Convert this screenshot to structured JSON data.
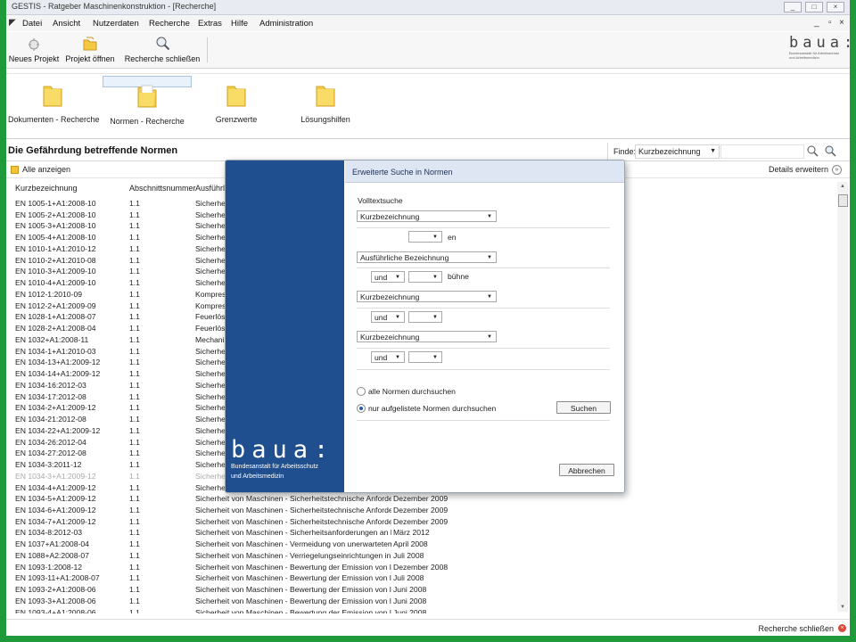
{
  "window": {
    "title": "GESTIS - Ratgeber Maschinenkonstruktion - [Recherche]",
    "controls": [
      "_",
      "□",
      "×"
    ]
  },
  "menu": [
    "Datei",
    "Ansicht",
    "Nutzerdaten",
    "Recherche",
    "Extras",
    "Hilfe",
    "Administration"
  ],
  "toolbar": {
    "new_project": "Neues Projekt",
    "open_project": "Projekt öffnen",
    "close_search": "Recherche schließen",
    "logo_text": "baua:",
    "logo_sub": "Bundesanstalt für Arbeitsschutz und Arbeitsmedizin"
  },
  "categories": [
    "Dokumenten - Recherche",
    "Normen - Recherche",
    "Grenzwerte",
    "Lösungshilfen"
  ],
  "selected_category": "Normen - Recherche",
  "section_title": "Die Gefährdung betreffende Normen",
  "find": {
    "label": "Finde:",
    "field": "Kurzbezeichnung"
  },
  "show_all": "Alle anzeigen",
  "details": "Details erweitern",
  "columns": [
    "Kurzbezeichnung",
    "Abschnittsnummer",
    "Ausführlic"
  ],
  "rows": [
    {
      "k": "EN 1005-1+A1:2008-10",
      "a": "1.1",
      "d": "Sicherheit",
      "dt": ""
    },
    {
      "k": "EN 1005-2+A1:2008-10",
      "a": "1.1",
      "d": "Sicherheit",
      "dt": ""
    },
    {
      "k": "EN 1005-3+A1:2008-10",
      "a": "1.1",
      "d": "Sicherheit",
      "dt": ""
    },
    {
      "k": "EN 1005-4+A1:2008-10",
      "a": "1.1",
      "d": "Sicherheit",
      "dt": ""
    },
    {
      "k": "EN 1010-1+A1:2010-12",
      "a": "1.1",
      "d": "Sicherheit",
      "dt": ""
    },
    {
      "k": "EN 1010-2+A1:2010-08",
      "a": "1.1",
      "d": "Sicherheit",
      "dt": ""
    },
    {
      "k": "EN 1010-3+A1:2009-10",
      "a": "1.1",
      "d": "Sicherheit",
      "dt": ""
    },
    {
      "k": "EN 1010-4+A1:2009-10",
      "a": "1.1",
      "d": "Sicherheit",
      "dt": ""
    },
    {
      "k": "EN 1012-1:2010-09",
      "a": "1.1",
      "d": "Kompress",
      "dt": ""
    },
    {
      "k": "EN 1012-2+A1:2009-09",
      "a": "1.1",
      "d": "Kompress",
      "dt": ""
    },
    {
      "k": "EN 1028-1+A1:2008-07",
      "a": "1.1",
      "d": "Feuerlösc",
      "dt": ""
    },
    {
      "k": "EN 1028-2+A1:2008-04",
      "a": "1.1",
      "d": "Feuerlösc",
      "dt": ""
    },
    {
      "k": "EN 1032+A1:2008-11",
      "a": "1.1",
      "d": "Mechanis",
      "dt": ""
    },
    {
      "k": "EN 1034-1+A1:2010-03",
      "a": "1.1",
      "d": "Sicherheit",
      "dt": ""
    },
    {
      "k": "EN 1034-13+A1:2009-12",
      "a": "1.1",
      "d": "Sicherheit",
      "dt": ""
    },
    {
      "k": "EN 1034-14+A1:2009-12",
      "a": "1.1",
      "d": "Sicherheit",
      "dt": ""
    },
    {
      "k": "EN 1034-16:2012-03",
      "a": "1.1",
      "d": "Sicherheit",
      "dt": ""
    },
    {
      "k": "EN 1034-17:2012-08",
      "a": "1.1",
      "d": "Sicherheit",
      "dt": ""
    },
    {
      "k": "EN 1034-2+A1:2009-12",
      "a": "1.1",
      "d": "Sicherheit",
      "dt": ""
    },
    {
      "k": "EN 1034-21:2012-08",
      "a": "1.1",
      "d": "Sicherheit",
      "dt": ""
    },
    {
      "k": "EN 1034-22+A1:2009-12",
      "a": "1.1",
      "d": "Sicherheit",
      "dt": ""
    },
    {
      "k": "EN 1034-26:2012-04",
      "a": "1.1",
      "d": "Sicherheit",
      "dt": ""
    },
    {
      "k": "EN 1034-27:2012-08",
      "a": "1.1",
      "d": "Sicherheit",
      "dt": ""
    },
    {
      "k": "EN 1034-3:2011-12",
      "a": "1.1",
      "d": "Sicherheit",
      "dt": ""
    },
    {
      "k": "EN 1034-3+A1:2009-12",
      "a": "1.1",
      "d": "Sicherheit",
      "dt": "",
      "faded": true
    },
    {
      "k": "EN 1034-4+A1:2009-12",
      "a": "1.1",
      "d": "Sicherheit",
      "dt": ""
    },
    {
      "k": "EN 1034-5+A1:2009-12",
      "a": "1.1",
      "d": "Sicherheit von Maschinen - Sicherheitstechnische Anforder...",
      "dt": "Dezember 2009"
    },
    {
      "k": "EN 1034-6+A1:2009-12",
      "a": "1.1",
      "d": "Sicherheit von Maschinen - Sicherheitstechnische Anforder...",
      "dt": "Dezember 2009"
    },
    {
      "k": "EN 1034-7+A1:2009-12",
      "a": "1.1",
      "d": "Sicherheit von Maschinen - Sicherheitstechnische Anforder...",
      "dt": "Dezember 2009"
    },
    {
      "k": "EN 1034-8:2012-03",
      "a": "1.1",
      "d": "Sicherheit von Maschinen - Sicherheitsanforderungen an K...",
      "dt": "März 2012"
    },
    {
      "k": "EN 1037+A1:2008-04",
      "a": "1.1",
      "d": "Sicherheit von Maschinen - Vermeidung von unerwartetem ...",
      "dt": "April 2008"
    },
    {
      "k": "EN 1088+A2:2008-07",
      "a": "1.1",
      "d": "Sicherheit von Maschinen - Verriegelungseinrichtungen in ...",
      "dt": "Juli 2008"
    },
    {
      "k": "EN 1093-1:2008-12",
      "a": "1.1",
      "d": "Sicherheit von Maschinen - Bewertung der Emission von lu...",
      "dt": "Dezember 2008"
    },
    {
      "k": "EN 1093-11+A1:2008-07",
      "a": "1.1",
      "d": "Sicherheit von Maschinen - Bewertung der Emission von lu...",
      "dt": "Juli 2008"
    },
    {
      "k": "EN 1093-2+A1:2008-06",
      "a": "1.1",
      "d": "Sicherheit von Maschinen - Bewertung der Emission von lu...",
      "dt": "Juni 2008"
    },
    {
      "k": "EN 1093-3+A1:2008-06",
      "a": "1.1",
      "d": "Sicherheit von Maschinen - Bewertung der Emission von lu...",
      "dt": "Juni 2008"
    },
    {
      "k": "EN 1093-4+A1:2008-06",
      "a": "1.1",
      "d": "Sicherheit von Maschinen - Bewertung der Emission von lu...",
      "dt": "Juni 2008"
    }
  ],
  "status": {
    "close_search": "Recherche schließen"
  },
  "dialog": {
    "title": "Erweiterte Suche in Normen",
    "fulltext_label": "Volltextsuche",
    "field1": "Kurzbezeichnung",
    "term1": "en",
    "field2": "Ausführliche Bezeichnung",
    "op2": "und",
    "term2": "bühne",
    "field3": "Kurzbezeichnung",
    "op3": "und",
    "field4": "Kurzbezeichnung",
    "op4": "und",
    "radio_all": "alle Normen durchsuchen",
    "radio_listed": "nur aufgelistete Normen durchsuchen",
    "search_button": "Suchen",
    "cancel_button": "Abbrechen",
    "logo_text": "baua:",
    "logo_sub1": "Bundesanstalt für Arbeitsschutz",
    "logo_sub2": "und Arbeitsmedizin"
  }
}
